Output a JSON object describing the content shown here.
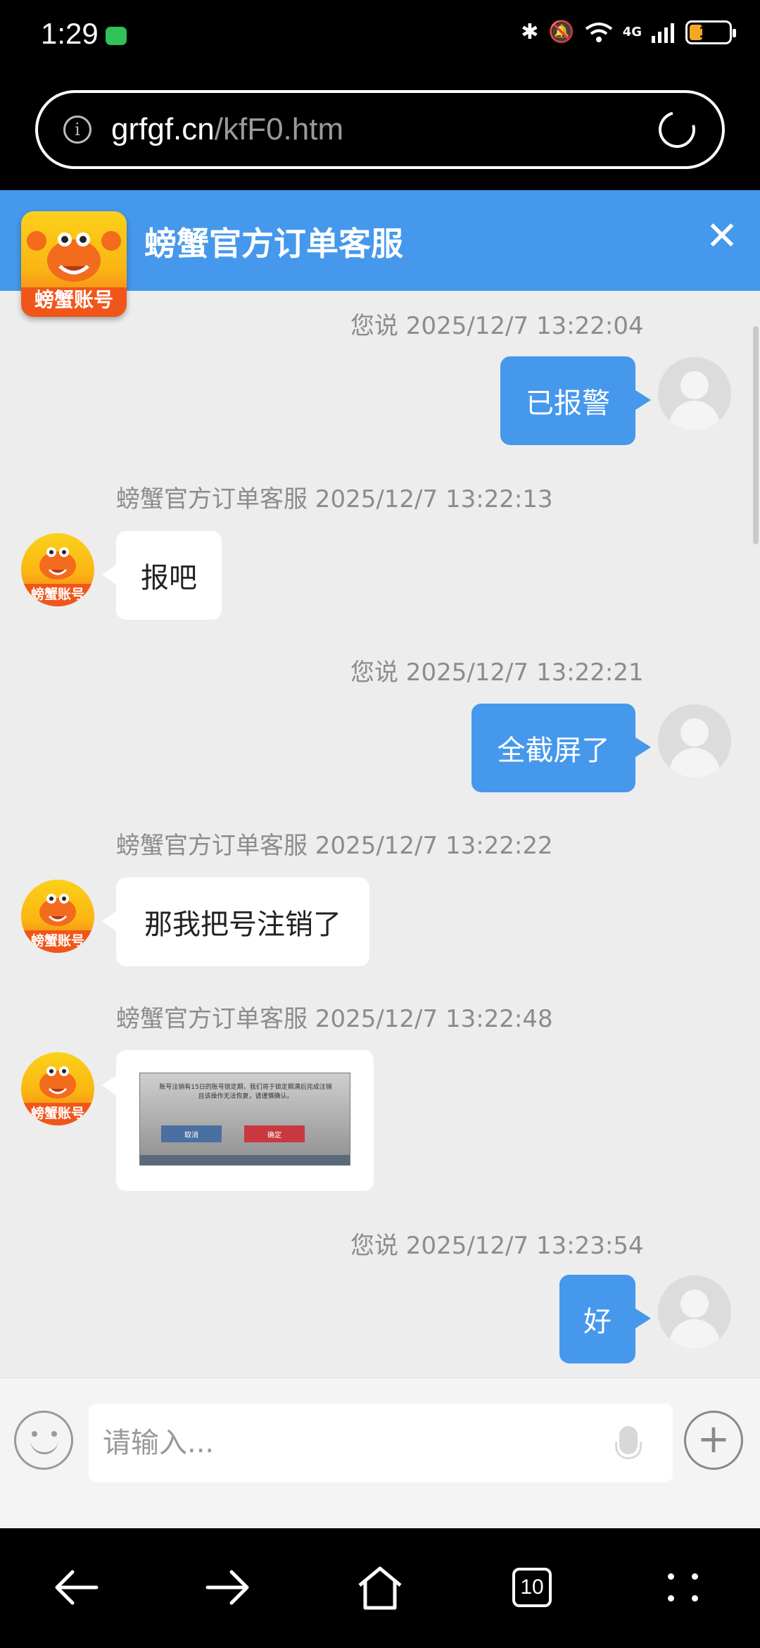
{
  "status_bar": {
    "time": "1:29",
    "network": "4G",
    "battery": "17",
    "battery_level": 0.17
  },
  "browser": {
    "url_domain": "grfgf.cn",
    "url_path": "/kfF0.htm",
    "tab_count": "10"
  },
  "header": {
    "title": "螃蟹官方订单客服",
    "logo_text": "螃蟹账号"
  },
  "messages": [
    {
      "sender": "me",
      "meta": "您说 2025/12/7 13:22:04",
      "text": "已报警"
    },
    {
      "sender": "cs",
      "meta": "螃蟹官方订单客服 2025/12/7 13:22:13",
      "text": "报吧"
    },
    {
      "sender": "me",
      "meta": "您说 2025/12/7 13:22:21",
      "text": "全截屏了"
    },
    {
      "sender": "cs",
      "meta": "螃蟹官方订单客服 2025/12/7 13:22:22",
      "text": "那我把号注销了"
    },
    {
      "sender": "cs",
      "meta": "螃蟹官方订单客服 2025/12/7 13:22:48",
      "image": {
        "text": "账号注销有15日的账号锁定期，我们将于锁定期满后完成注销且该操作无法恢复，请谨慎确认。",
        "cancel": "取消",
        "confirm": "确定"
      }
    },
    {
      "sender": "me",
      "meta": "您说 2025/12/7 13:23:54",
      "text": "好"
    }
  ],
  "input": {
    "placeholder": "请输入..."
  },
  "colors": {
    "accent": "#4598ec",
    "chat_bg": "#ededed"
  }
}
